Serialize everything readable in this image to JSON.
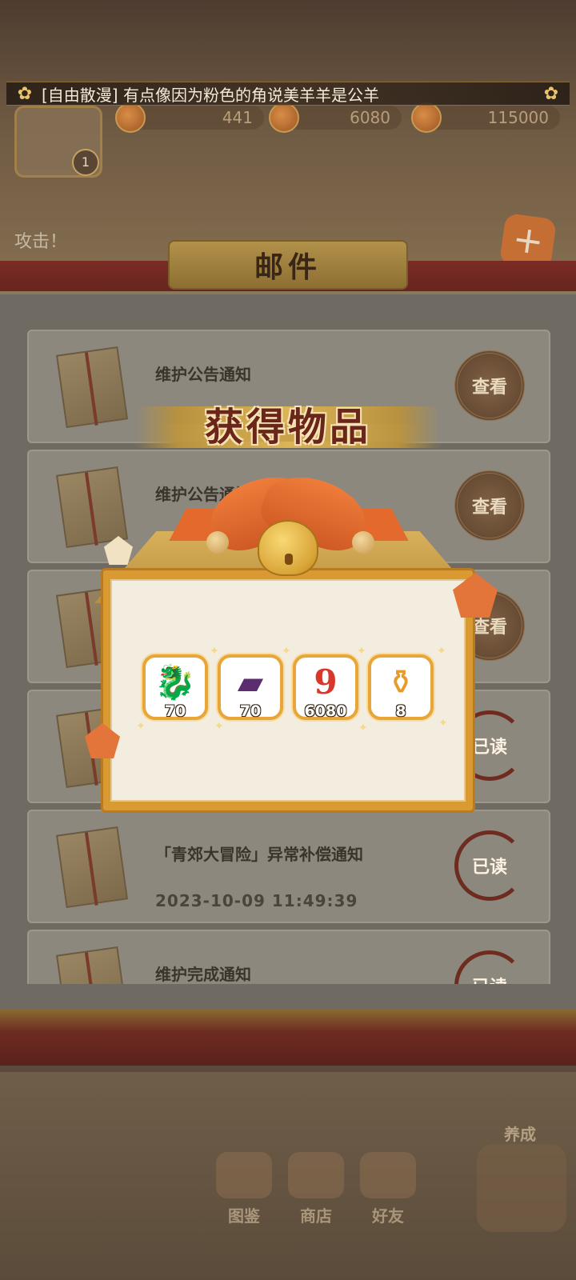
{
  "ticker": {
    "text": "[自由散漫] 有点像因为粉色的角说美羊羊是公羊"
  },
  "resources": {
    "stamina": "441",
    "gems": "6080",
    "coins": "115000"
  },
  "player": {
    "level": "1"
  },
  "scene": {
    "attack_text": "攻击！"
  },
  "mail_panel": {
    "title": "邮件",
    "items": [
      {
        "title": "维护公告通知",
        "date": "",
        "action": "查看"
      },
      {
        "title": "维护公告通知",
        "date": "",
        "action": "查看"
      },
      {
        "title": "",
        "date": "",
        "action": "查看"
      },
      {
        "title": "",
        "date": "",
        "action": "已读"
      },
      {
        "title": "「青郊大冒险」异常补偿通知",
        "date": "2023-10-09 11:49:39",
        "action": "已读"
      },
      {
        "title": "维护完成通知",
        "date": "",
        "action": "已读"
      }
    ]
  },
  "reward_popup": {
    "title": "获得物品",
    "items": [
      {
        "icon": "dragon-figure-icon",
        "count": "70"
      },
      {
        "icon": "purple-ticket-icon",
        "count": "70"
      },
      {
        "icon": "red-nine-gem-icon",
        "count": "6080"
      },
      {
        "icon": "stamina-potion-icon",
        "count": "8"
      }
    ]
  },
  "bottom_nav": {
    "items": [
      {
        "label": "图鉴",
        "icon": "codex-icon"
      },
      {
        "label": "商店",
        "icon": "shop-icon"
      },
      {
        "label": "好友",
        "icon": "friends-icon"
      }
    ],
    "train_label": "养成"
  },
  "colors": {
    "accent_gold": "#d99a32",
    "ribbon_orange": "#e36a2c",
    "panel_red": "#7a2c24"
  }
}
